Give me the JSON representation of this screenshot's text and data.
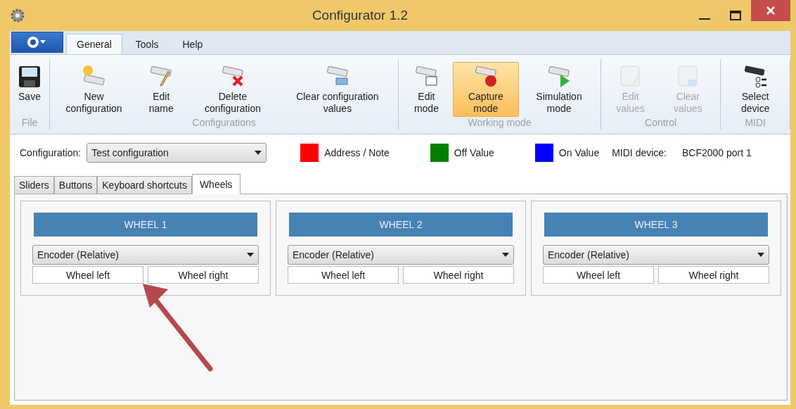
{
  "window": {
    "title": "Configurator 1.2"
  },
  "ribbon_tabs": [
    {
      "label": "General",
      "selected": true
    },
    {
      "label": "Tools",
      "selected": false
    },
    {
      "label": "Help",
      "selected": false
    }
  ],
  "ribbon_groups": [
    {
      "label": "File",
      "buttons": [
        {
          "kind": "save",
          "label": "Save",
          "selected": false,
          "disabled": false
        }
      ]
    },
    {
      "label": "Configurations",
      "buttons": [
        {
          "kind": "new",
          "label": "New configuration",
          "selected": false,
          "disabled": false
        },
        {
          "kind": "edit",
          "label": "Edit name",
          "selected": false,
          "disabled": false
        },
        {
          "kind": "delete",
          "label": "Delete configuration",
          "selected": false,
          "disabled": false
        },
        {
          "kind": "clear",
          "label": "Clear configuration values",
          "selected": false,
          "disabled": false
        }
      ]
    },
    {
      "label": "Working mode",
      "buttons": [
        {
          "kind": "editmode",
          "label": "Edit mode",
          "selected": false,
          "disabled": false
        },
        {
          "kind": "capture",
          "label": "Capture mode",
          "selected": true,
          "disabled": false
        },
        {
          "kind": "simulate",
          "label": "Simulation mode",
          "selected": false,
          "disabled": false
        }
      ]
    },
    {
      "label": "Control",
      "buttons": [
        {
          "kind": "editvalues",
          "label": "Edit values",
          "selected": false,
          "disabled": true
        },
        {
          "kind": "clearvalues",
          "label": "Clear values",
          "selected": false,
          "disabled": true
        }
      ]
    },
    {
      "label": "MIDI",
      "buttons": [
        {
          "kind": "device",
          "label": "Select device",
          "selected": false,
          "disabled": false
        }
      ]
    }
  ],
  "configuration": {
    "label": "Configuration:",
    "value": "Test configuration"
  },
  "legend": [
    {
      "label": "Address / Note",
      "color": "#ff0000"
    },
    {
      "label": "Off Value",
      "color": "#008000"
    },
    {
      "label": "On Value",
      "color": "#0000ff"
    }
  ],
  "midi_device": {
    "label": "MIDI device:",
    "value": "BCF2000 port 1"
  },
  "tabs": [
    {
      "label": "Sliders",
      "selected": false
    },
    {
      "label": "Buttons",
      "selected": false
    },
    {
      "label": "Keyboard shortcuts",
      "selected": false
    },
    {
      "label": "Wheels",
      "selected": true
    }
  ],
  "wheels": [
    {
      "title": "WHEEL 1",
      "mode": "Encoder (Relative)",
      "buttons": [
        "Wheel left",
        "Wheel right"
      ]
    },
    {
      "title": "WHEEL 2",
      "mode": "Encoder (Relative)",
      "buttons": [
        "Wheel left",
        "Wheel right"
      ]
    },
    {
      "title": "WHEEL 3",
      "mode": "Encoder (Relative)",
      "buttons": [
        "Wheel left",
        "Wheel right"
      ]
    }
  ]
}
